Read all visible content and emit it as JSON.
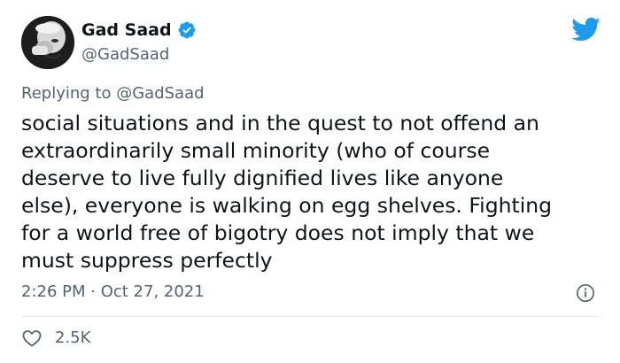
{
  "author": {
    "display_name": "Gad Saad",
    "handle": "@GadSaad",
    "verified": true
  },
  "reply_context": {
    "prefix": "Replying to",
    "mention": "@GadSaad"
  },
  "tweet": {
    "text": "social situations and in the quest to not offend an\nextraordinarily small minority (who of course\ndeserve to live fully dignified lives like anyone\nelse), everyone is walking on egg shelves. Fighting\nfor a world free of bigotry does not imply that we\nmust suppress perfectly",
    "timestamp": "2:26 PM · Oct 27, 2021",
    "likes": "2.5K"
  },
  "icons": {
    "brand": "twitter-bird-icon",
    "verified": "verified-badge-icon",
    "info": "info-icon",
    "like": "heart-icon"
  },
  "colors": {
    "brand_blue": "#1d9bf0",
    "secondary_text": "#536471",
    "primary_text": "#0f1419",
    "divider": "#e1e8ed"
  }
}
